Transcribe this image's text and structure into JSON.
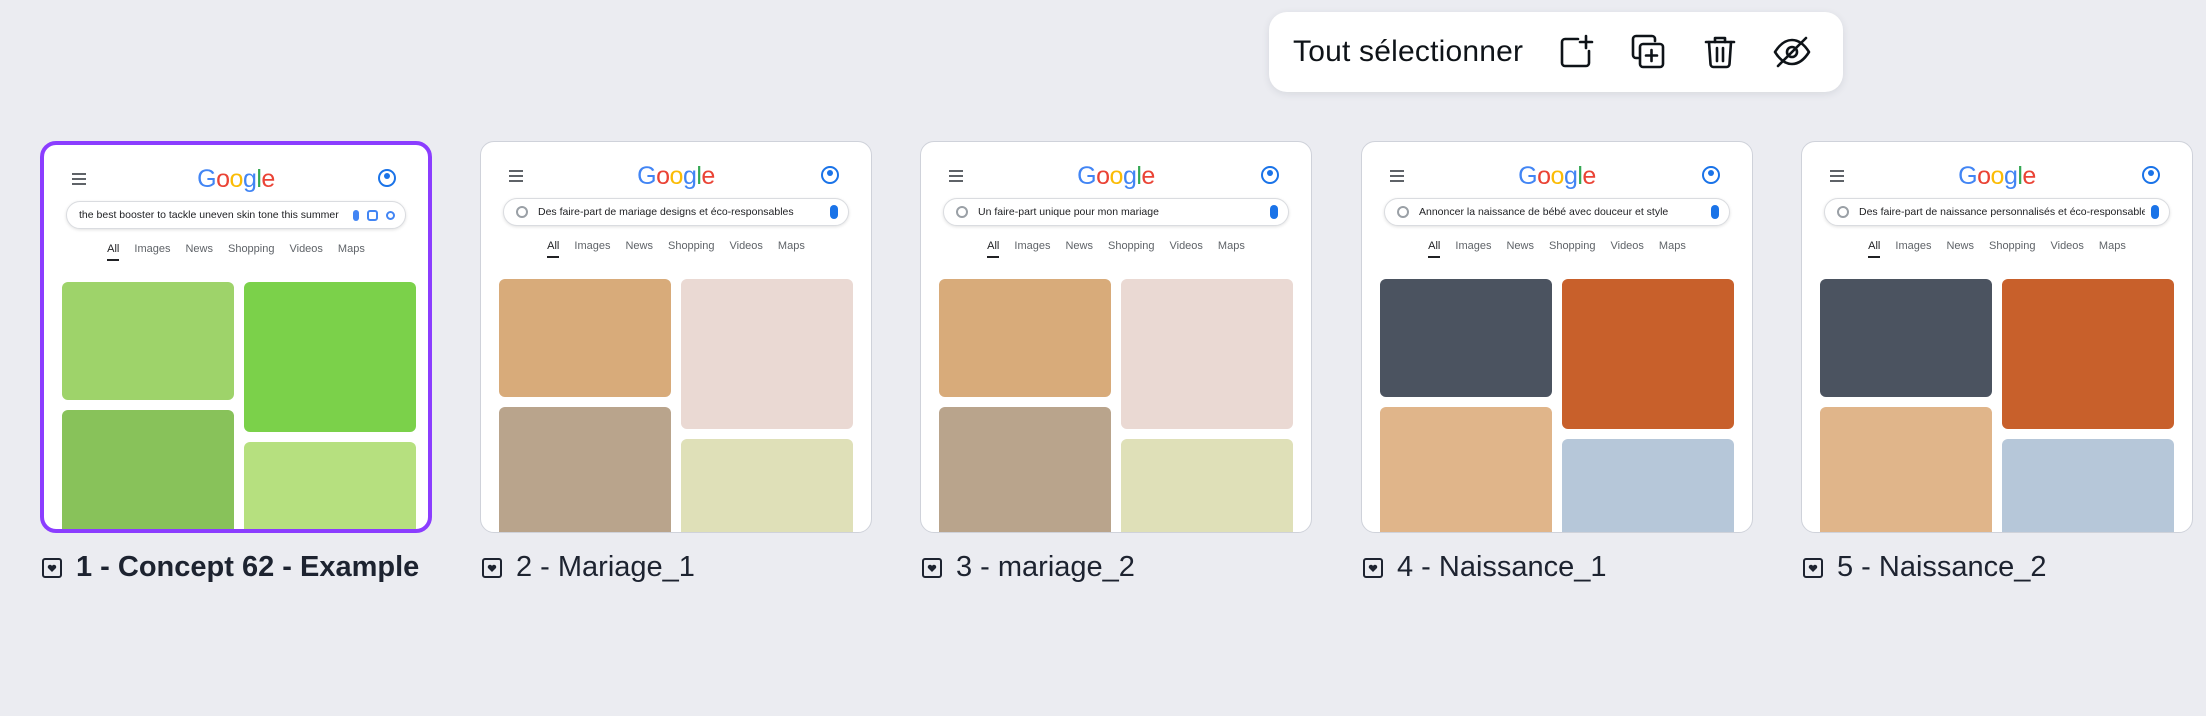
{
  "toolbar": {
    "select_all_label": "Tout sélectionner",
    "icons": [
      "add-page-icon",
      "duplicate-icon",
      "trash-icon",
      "hide-icon"
    ]
  },
  "pages": [
    {
      "label": "1 - Concept 62 - Example",
      "selected": true,
      "search_query": "the best booster to tackle uneven skin tone this summer",
      "tabs": [
        "All",
        "Images",
        "News",
        "Shopping",
        "Videos",
        "Maps"
      ],
      "image_colors": [
        "#9ed36a",
        "#7bd14a",
        "#88c25a",
        "#b6e07f"
      ]
    },
    {
      "label": "2 - Mariage_1",
      "selected": false,
      "search_query": "Des faire-part de mariage designs et éco-responsables",
      "tabs": [
        "All",
        "Images",
        "News",
        "Shopping",
        "Videos",
        "Maps"
      ],
      "image_colors": [
        "#d8ab7a",
        "#ead9d3",
        "#b9a48c",
        "#dfe0b8"
      ]
    },
    {
      "label": "3 - mariage_2",
      "selected": false,
      "search_query": "Un faire-part unique pour mon mariage",
      "tabs": [
        "All",
        "Images",
        "News",
        "Shopping",
        "Videos",
        "Maps"
      ],
      "image_colors": [
        "#d8ab7a",
        "#ead9d3",
        "#b9a48c",
        "#dfe0b8"
      ]
    },
    {
      "label": "4 - Naissance_1",
      "selected": false,
      "search_query": "Annoncer la naissance de bébé avec douceur et style",
      "tabs": [
        "All",
        "Images",
        "News",
        "Shopping",
        "Videos",
        "Maps"
      ],
      "image_colors": [
        "#4b5360",
        "#c8602b",
        "#e0b58a",
        "#b6c7d9"
      ]
    },
    {
      "label": "5 - Naissance_2",
      "selected": false,
      "search_query": "Des faire-part de naissance personnalisés et éco-responsables",
      "tabs": [
        "All",
        "Images",
        "News",
        "Shopping",
        "Videos",
        "Maps"
      ],
      "image_colors": [
        "#4b5360",
        "#c8602b",
        "#e0b58a",
        "#b6c7d9"
      ]
    }
  ],
  "google_logo": "Google",
  "colors": {
    "selection": "#8b3dff",
    "background": "#ebecf1"
  }
}
